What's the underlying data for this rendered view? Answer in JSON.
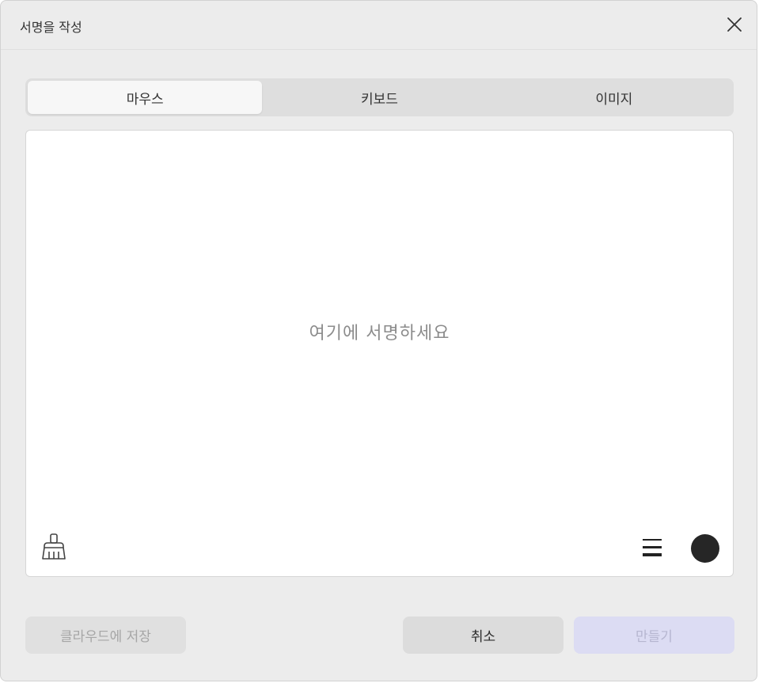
{
  "dialog": {
    "title": "서명을 작성",
    "close_icon": "close-icon"
  },
  "tabs": [
    {
      "label": "마우스",
      "active": true
    },
    {
      "label": "키보드",
      "active": false
    },
    {
      "label": "이미지",
      "active": false
    }
  ],
  "canvas": {
    "placeholder": "여기에 서명하세요",
    "clear_icon": "broom-icon",
    "thickness_icon": "line-thickness-icon",
    "pen_color": "#262626"
  },
  "footer": {
    "save_cloud_label": "클라우드에 저장",
    "cancel_label": "취소",
    "create_label": "만들기"
  },
  "colors": {
    "accent_disabled": "#dcdcf3"
  }
}
